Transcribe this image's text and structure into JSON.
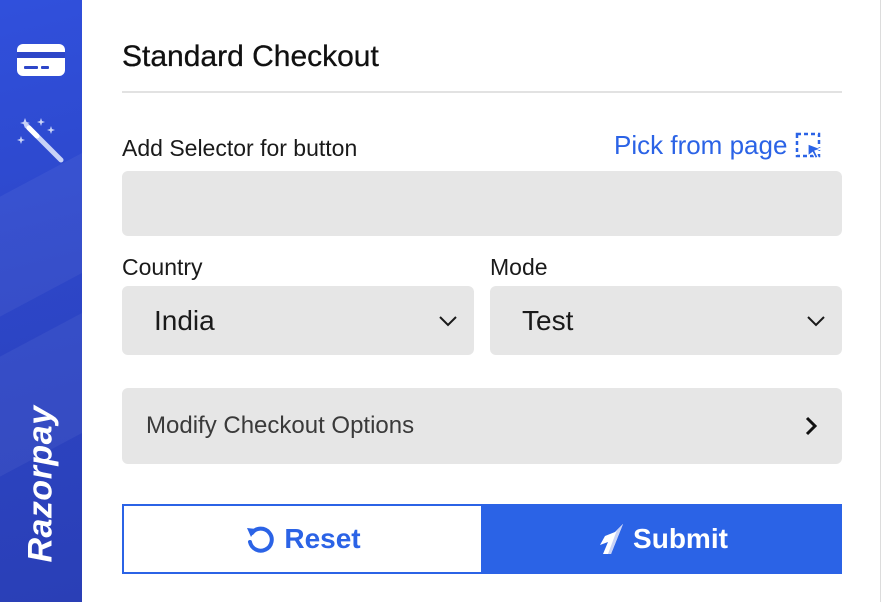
{
  "brand": {
    "name": "Razorpay"
  },
  "sidebar": {
    "items": [
      {
        "icon": "credit-card-icon"
      },
      {
        "icon": "magic-wand-icon"
      }
    ]
  },
  "panel": {
    "title": "Standard Checkout",
    "selector_label": "Add Selector for button",
    "pick_label": "Pick from page",
    "pick_icon": "select-element-icon",
    "selector_value": "",
    "country_label": "Country",
    "country_value": "India",
    "mode_label": "Mode",
    "mode_value": "Test",
    "modify_options_label": "Modify Checkout Options",
    "reset_label": "Reset",
    "submit_label": "Submit"
  },
  "colors": {
    "accent": "#2b63e6",
    "sidebar": "#2d46c8",
    "field_bg": "#e6e6e6"
  }
}
